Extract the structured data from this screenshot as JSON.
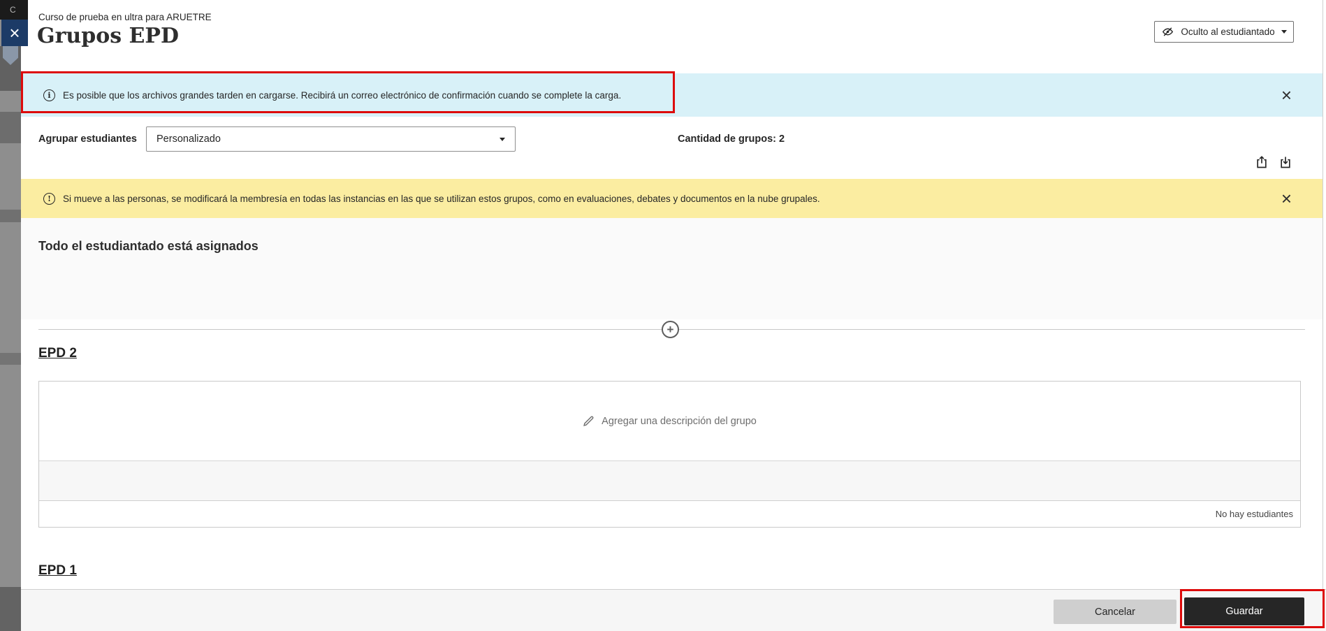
{
  "background": {
    "corner_letter": "C"
  },
  "header": {
    "breadcrumb": "Curso de prueba en ultra para ARUETRE",
    "title": "Grupos EPD",
    "visibility_button_label": "Oculto al estudiantado"
  },
  "banners": {
    "info_message": "Es posible que los archivos grandes tarden en cargarse. Recibirá un correo electrónico de confirmación cuando se complete la carga.",
    "warning_message": "Si mueve a las personas, se modificará la membresía en todas las instancias en las que se utilizan estos grupos, como en evaluaciones, debates y documentos en la nube grupales."
  },
  "toolbar": {
    "group_students_label": "Agrupar estudiantes",
    "group_students_selected": "Personalizado",
    "group_count": "Cantidad de grupos: 2"
  },
  "content": {
    "all_assigned_heading": "Todo el estudiantado está asignados"
  },
  "groups": [
    {
      "name": "EPD 2",
      "description_placeholder": "Agregar una descripción del grupo",
      "empty_text": "No hay estudiantes"
    },
    {
      "name": "EPD 1"
    }
  ],
  "footer": {
    "cancel_label": "Cancelar",
    "save_label": "Guardar"
  },
  "icons": {
    "close": "×",
    "info": "i",
    "warning": "!",
    "plus": "+"
  },
  "colors": {
    "info_banner_bg": "#d8f1f8",
    "warning_banner_bg": "#fbeda1",
    "annotation_red": "#dd0b0b",
    "save_button_bg": "#262626",
    "save_button_text": "#ffffff",
    "cancel_button_bg": "#cfcfcf",
    "course_close_bg": "#1c3b67",
    "footer_bg": "#f6f6f6",
    "assigned_section_bg": "#fafafa"
  }
}
